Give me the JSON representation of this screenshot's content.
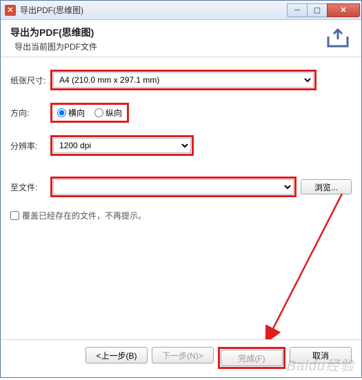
{
  "window": {
    "title": "导出PDF(思维图)"
  },
  "header": {
    "title": "导出为PDF(思维图)",
    "subtitle": "导出当前图为PDF文件"
  },
  "form": {
    "paper_label": "纸张尺寸:",
    "paper_value": "A4 (210.0 mm x 297.1 mm)",
    "orientation_label": "方向:",
    "orientation_h": "横向",
    "orientation_v": "纵向",
    "orientation_selected": "horizontal",
    "dpi_label": "分辨率:",
    "dpi_value": "1200 dpi",
    "file_label": "至文件:",
    "file_value": "",
    "browse_label": "浏览...",
    "overwrite_label": "覆盖已经存在的文件，不再提示。"
  },
  "footer": {
    "back": "<上一步(B)",
    "next": "下一步(N)>",
    "finish": "完成(F)",
    "cancel": "取消"
  },
  "watermark": "Baidu经验"
}
